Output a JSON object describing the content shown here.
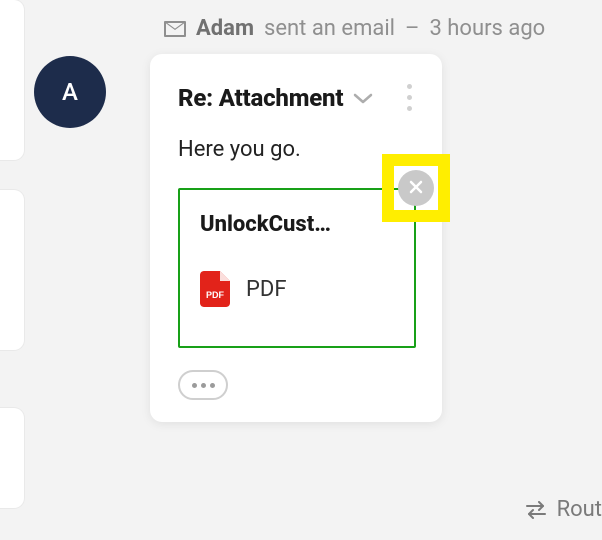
{
  "timeline": {
    "sender": "Adam",
    "action_text": "sent an email",
    "time_separator": "–",
    "time_ago": "3 hours ago"
  },
  "avatar": {
    "initial": "A"
  },
  "message": {
    "subject": "Re: Attachment",
    "body": "Here you go.",
    "attachment": {
      "filename_display": "UnlockCust…",
      "type_label": "PDF",
      "pdf_badge_text": "PDF"
    }
  },
  "footer": {
    "route_label": "Rout"
  }
}
